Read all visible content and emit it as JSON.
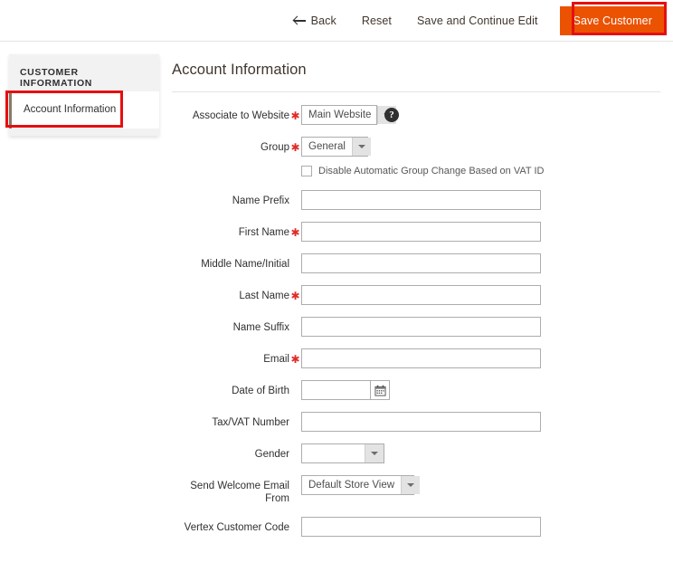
{
  "page_actions": {
    "back_label": "Back",
    "reset_label": "Reset",
    "save_continue_label": "Save and Continue Edit",
    "save_label": "Save Customer",
    "primary_color": "#eb5202",
    "annotation_color": "#e50f0f"
  },
  "sidebar": {
    "title": "CUSTOMER INFORMATION",
    "items": [
      {
        "label": "Account Information",
        "active": true
      }
    ]
  },
  "main": {
    "section_title": "Account Information",
    "fields": [
      {
        "label": "Associate to Website",
        "required": true,
        "type": "select",
        "value": "Main Website",
        "help": "?"
      },
      {
        "label": "Group",
        "required": true,
        "type": "select",
        "value": "General"
      },
      {
        "label": "Name Prefix",
        "required": false,
        "type": "text",
        "value": ""
      },
      {
        "label": "First Name",
        "required": true,
        "type": "text",
        "value": ""
      },
      {
        "label": "Middle Name/Initial",
        "required": false,
        "type": "text",
        "value": ""
      },
      {
        "label": "Last Name",
        "required": true,
        "type": "text",
        "value": ""
      },
      {
        "label": "Name Suffix",
        "required": false,
        "type": "text",
        "value": ""
      },
      {
        "label": "Email",
        "required": true,
        "type": "text",
        "value": ""
      },
      {
        "label": "Date of Birth",
        "required": false,
        "type": "date",
        "value": ""
      },
      {
        "label": "Tax/VAT Number",
        "required": false,
        "type": "text",
        "value": ""
      },
      {
        "label": "Gender",
        "required": false,
        "type": "select",
        "value": ""
      },
      {
        "label": "Send Welcome Email From",
        "required": false,
        "type": "select",
        "value": "Default Store View"
      },
      {
        "label": "Vertex Customer Code",
        "required": false,
        "type": "text",
        "value": ""
      }
    ],
    "vat_checkbox": {
      "label": "Disable Automatic Group Change Based on VAT ID",
      "checked": false
    }
  }
}
